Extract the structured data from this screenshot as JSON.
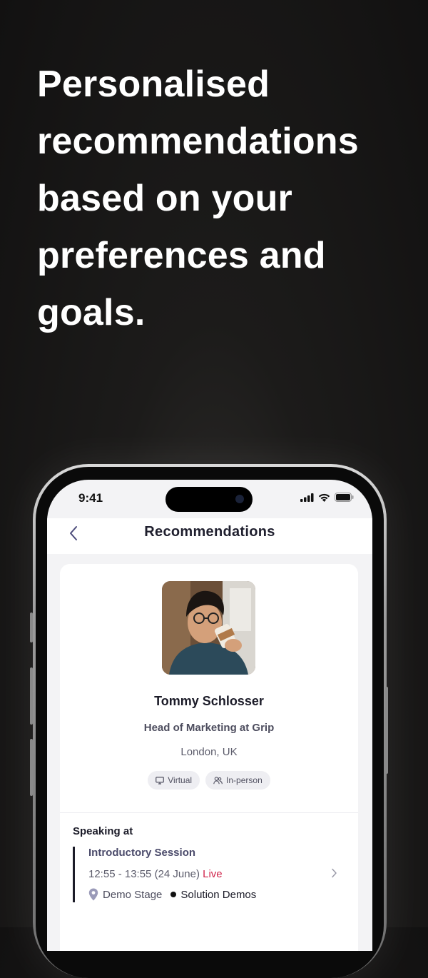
{
  "headline": {
    "lines": [
      "Personalised",
      "recommendations",
      "based on your",
      "preferences and",
      "goals."
    ]
  },
  "status_bar": {
    "time": "9:41",
    "icons": [
      "cellular-signal-icon",
      "wifi-icon",
      "battery-icon"
    ]
  },
  "nav": {
    "back_icon": "chevron-left-icon",
    "title": "Recommendations"
  },
  "profile": {
    "name": "Tommy Schlosser",
    "role": "Head of Marketing at Grip",
    "location": "London, UK",
    "tags": [
      {
        "label": "Virtual",
        "icon": "monitor-icon"
      },
      {
        "label": "In-person",
        "icon": "people-icon"
      }
    ]
  },
  "speaking": {
    "label": "Speaking at",
    "session": {
      "title": "Introductory Session",
      "time": "12:55 - 13:55 (24 June)",
      "status": "Live",
      "venue": "Demo Stage",
      "track": "Solution Demos"
    }
  },
  "colors": {
    "live": "#d0234a",
    "nav_text": "#4a4a7a",
    "screen_bg": "#f3f3f5"
  }
}
